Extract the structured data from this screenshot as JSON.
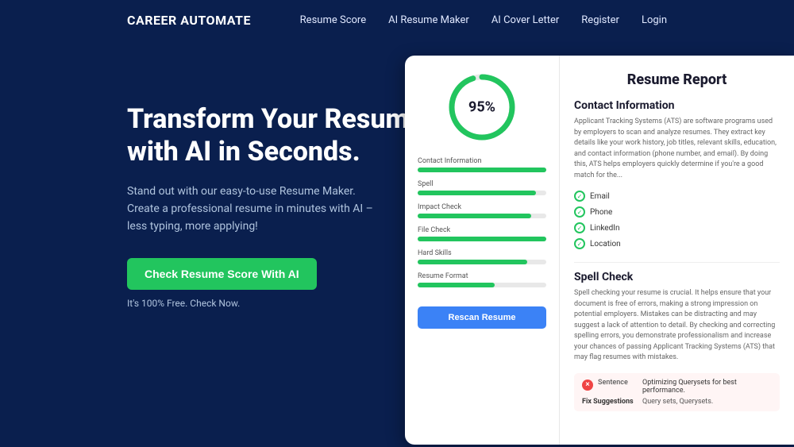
{
  "nav": {
    "logo": "CAREER AUTOMATE",
    "links": [
      {
        "label": "Resume Score",
        "id": "resume-score"
      },
      {
        "label": "AI Resume Maker",
        "id": "ai-resume-maker"
      },
      {
        "label": "AI Cover Letter",
        "id": "ai-cover-letter"
      },
      {
        "label": "Register",
        "id": "register"
      },
      {
        "label": "Login",
        "id": "login"
      }
    ]
  },
  "hero": {
    "title": "Transform Your Resume with AI in Seconds.",
    "subtitle": "Stand out with our easy-to-use Resume Maker. Create a professional resume in minutes with AI – less typing, more applying!",
    "cta_button": "Check Resume Score With AI",
    "cta_sub": "It's 100% Free. Check Now."
  },
  "resume_card": {
    "score": "95%",
    "score_value": 95,
    "bars": [
      {
        "label": "Contact Information",
        "percent": 100
      },
      {
        "label": "Spell",
        "percent": 92
      },
      {
        "label": "Impact Check",
        "percent": 88
      },
      {
        "label": "File Check",
        "percent": 100
      },
      {
        "label": "Hard Skills",
        "percent": 85
      },
      {
        "label": "Resume Format",
        "percent": 60
      }
    ],
    "rescan_button": "Rescan Resume",
    "report_title": "Resume Report",
    "contact_section": {
      "heading": "Contact Information",
      "desc": "Applicant Tracking Systems (ATS) are software programs used by employers to scan and analyze resumes. They extract key details like your work history, job titles, relevant skills, education, and contact information (phone number, and email). By doing this, ATS helps employers quickly determine if you're a good match for the...",
      "items": [
        "Email",
        "Phone",
        "LinkedIn",
        "Location"
      ]
    },
    "spell_section": {
      "heading": "Spell Check",
      "desc": "Spell checking your resume is crucial. It helps ensure that your document is free of errors, making a strong impression on potential employers. Mistakes can be distracting and may suggest a lack of attention to detail. By checking and correcting spelling errors, you demonstrate professionalism and increase your chances of passing Applicant Tracking Systems (ATS) that may flag resumes with mistakes.",
      "issue": {
        "sentence_label": "Sentence",
        "sentence_value": "Optimizing Querysets for best performance.",
        "fix_label": "Fix Suggestions",
        "fix_value": "Query sets, Querysets."
      }
    }
  }
}
